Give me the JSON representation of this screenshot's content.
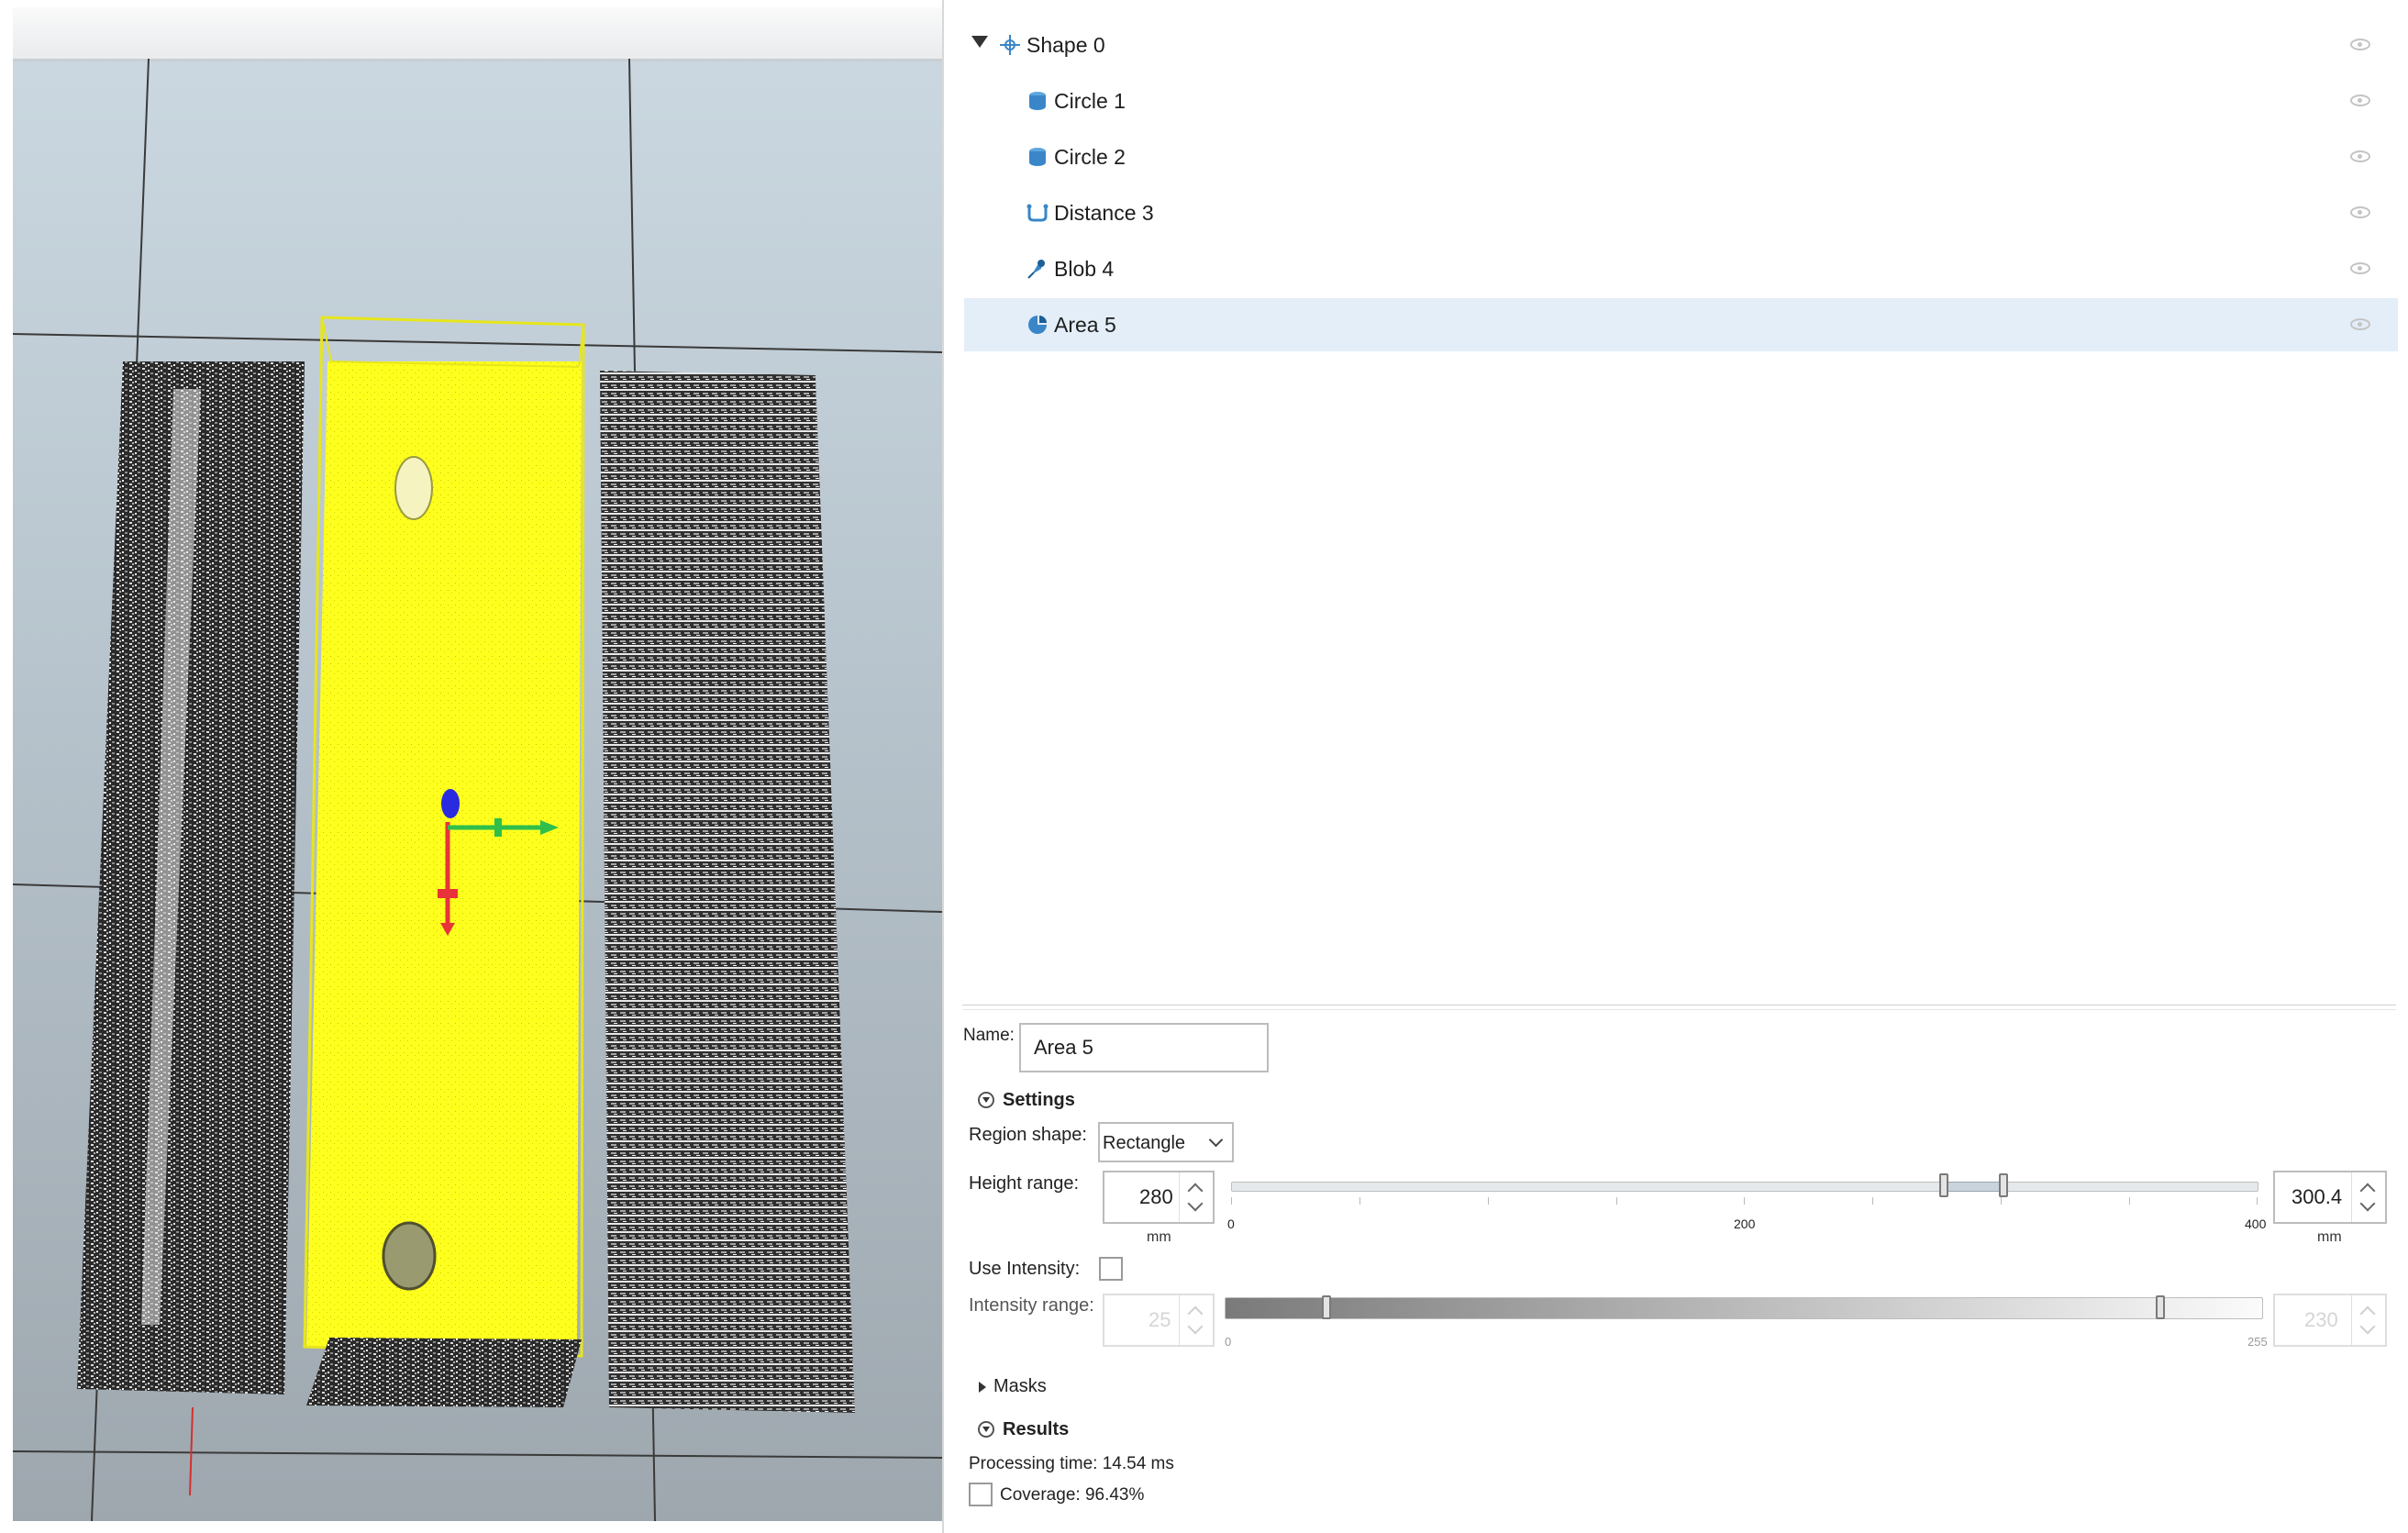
{
  "tree": {
    "root": {
      "label": "Shape 0",
      "icon": "shape-icon"
    },
    "items": [
      {
        "label": "Circle 1",
        "icon": "circle-tool-icon"
      },
      {
        "label": "Circle 2",
        "icon": "circle-tool-icon"
      },
      {
        "label": "Distance 3",
        "icon": "distance-tool-icon"
      },
      {
        "label": "Blob 4",
        "icon": "blob-tool-icon"
      },
      {
        "label": "Area 5",
        "icon": "area-tool-icon",
        "selected": true
      }
    ]
  },
  "properties": {
    "name_label": "Name:",
    "name_value": "Area 5",
    "settings_label": "Settings",
    "region_shape_label": "Region shape:",
    "region_shape_value": "Rectangle",
    "height_range": {
      "label": "Height range:",
      "min_value": "280",
      "max_value": "300.4",
      "unit": "mm",
      "scale": [
        "0",
        "200",
        "400"
      ],
      "scale_range": [
        0,
        400
      ]
    },
    "use_intensity_label": "Use Intensity:",
    "use_intensity_checked": false,
    "intensity_range": {
      "label": "Intensity range:",
      "min_value": "25",
      "max_value": "230",
      "scale": [
        "0",
        "255"
      ],
      "scale_range": [
        0,
        255
      ]
    },
    "masks_label": "Masks",
    "results_label": "Results",
    "processing_time": "Processing time: 14.54 ms",
    "coverage": "Coverage: 96.43%"
  },
  "colors": {
    "selection": "#e3eef8",
    "area_region": "#ffff1e",
    "tree_icon_blue": "#3a86c8"
  }
}
